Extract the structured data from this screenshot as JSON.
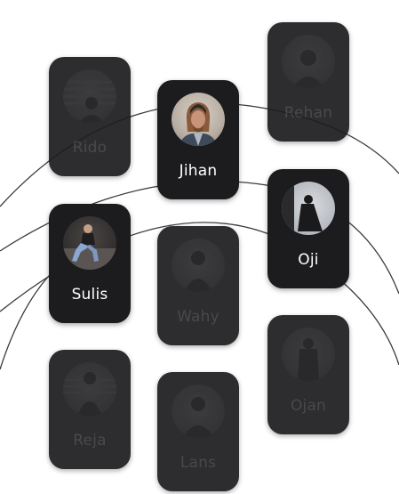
{
  "profiles": [
    {
      "name": "Rido",
      "state": "dim",
      "avatar_icon": "person-photo-icon"
    },
    {
      "name": "Jihan",
      "state": "active",
      "avatar_icon": "person-photo-icon"
    },
    {
      "name": "Rehan",
      "state": "dim",
      "avatar_icon": "person-photo-icon"
    },
    {
      "name": "Sulis",
      "state": "active",
      "avatar_icon": "person-photo-icon"
    },
    {
      "name": "Wahy",
      "state": "dim",
      "avatar_icon": "person-photo-icon"
    },
    {
      "name": "Oji",
      "state": "active",
      "avatar_icon": "person-photo-icon"
    },
    {
      "name": "Reja",
      "state": "dim",
      "avatar_icon": "person-photo-icon"
    },
    {
      "name": "Lans",
      "state": "dim",
      "avatar_icon": "person-photo-icon"
    },
    {
      "name": "Ojan",
      "state": "dim",
      "avatar_icon": "person-photo-icon"
    }
  ],
  "colors": {
    "card": "#1c1c1e",
    "active_text": "#ffffff",
    "dim_text": "#3a3a3d",
    "arc": "#3c3c3c"
  }
}
